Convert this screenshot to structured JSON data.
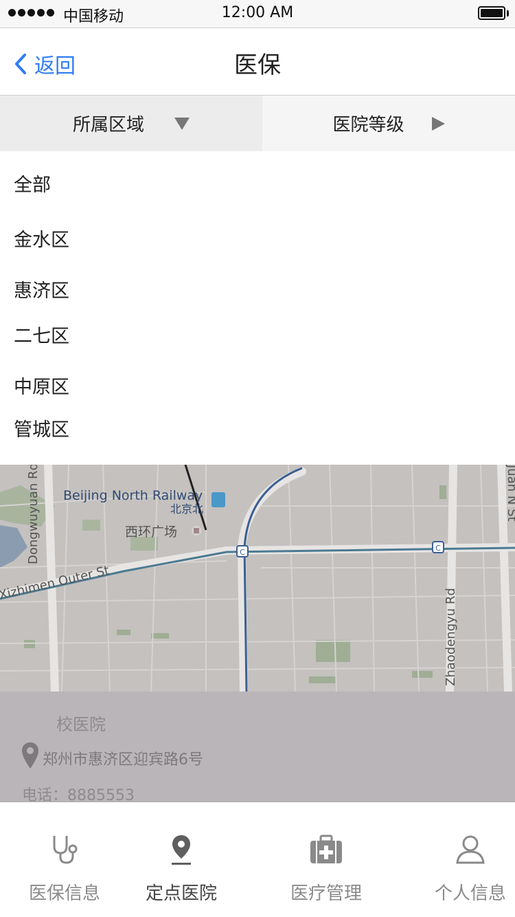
{
  "status_bar": {
    "carrier": "中国移动",
    "time": "12:00 AM"
  },
  "nav": {
    "back_label": "返回",
    "title": "医保"
  },
  "filters": {
    "region_label": "所属区域",
    "level_label": "医院等级"
  },
  "region_options": [
    "全部",
    "金水区",
    "惠济区",
    "二七区",
    "中原区",
    "管城区"
  ],
  "map": {
    "labels": [
      "Beijing North Railway",
      "北京北",
      "西环广场",
      "Dongwuyuan Rd",
      "Xizhimen Outer St",
      "Zhaodengyu Rd",
      "Juan N St"
    ]
  },
  "hospital_card": {
    "name": "校医院",
    "address": "郑州市惠济区迎宾路6号",
    "phone": "电话：8885553"
  },
  "tab_bar": {
    "items": [
      "医保信息",
      "定点医院",
      "医疗管理",
      "个人信息"
    ],
    "active_index": 1
  },
  "colors": {
    "accent": "#2f7df6",
    "map_bg": "#c4c1bf",
    "info_bg": "#bab5b9"
  }
}
